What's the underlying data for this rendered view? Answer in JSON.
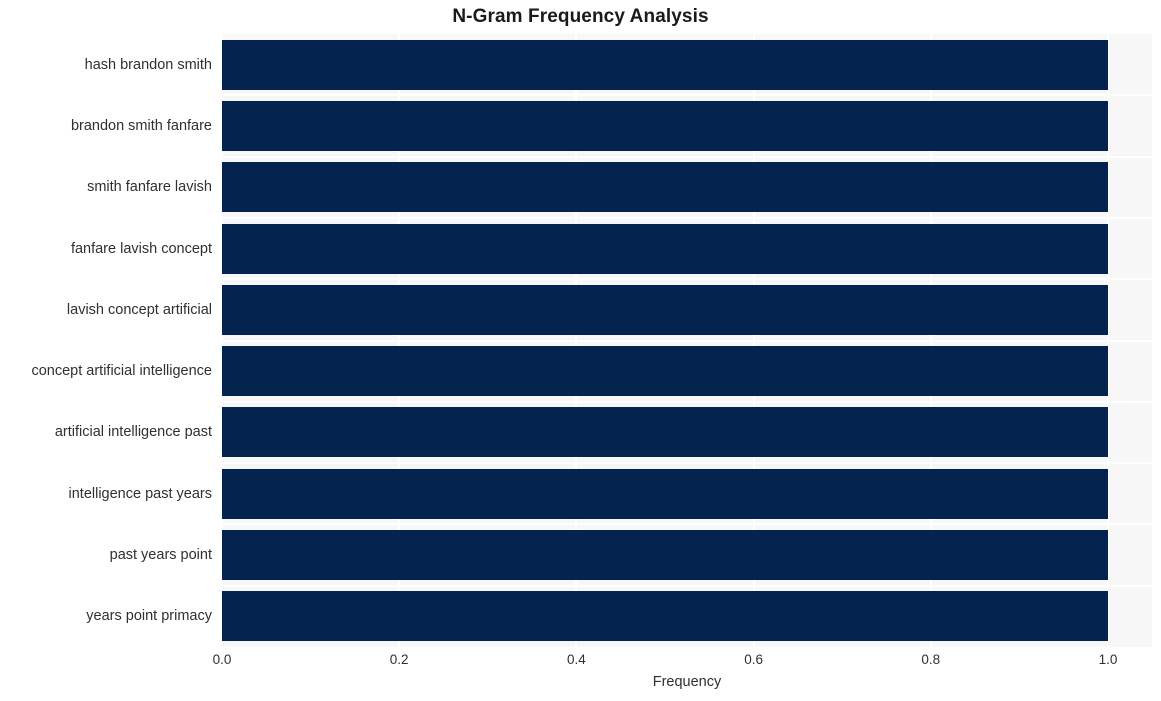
{
  "chart_data": {
    "type": "bar",
    "orientation": "horizontal",
    "title": "N-Gram Frequency Analysis",
    "xlabel": "Frequency",
    "ylabel": "",
    "categories": [
      "hash brandon smith",
      "brandon smith fanfare",
      "smith fanfare lavish",
      "fanfare lavish concept",
      "lavish concept artificial",
      "concept artificial intelligence",
      "artificial intelligence past",
      "intelligence past years",
      "past years point",
      "years point primacy"
    ],
    "values": [
      1.0,
      1.0,
      1.0,
      1.0,
      1.0,
      1.0,
      1.0,
      1.0,
      1.0,
      1.0
    ],
    "xlim": [
      0.0,
      1.0
    ],
    "xticks": [
      "0.0",
      "0.2",
      "0.4",
      "0.6",
      "0.8",
      "1.0"
    ],
    "xtick_values": [
      0.0,
      0.2,
      0.4,
      0.6,
      0.8,
      1.0
    ],
    "grid": true,
    "legend": false,
    "bar_color": "#04244f",
    "panel_background": "#f7f7f7",
    "grid_color": "#ffffff",
    "text_color": "#303030",
    "title_color": "#1a1a1a"
  }
}
